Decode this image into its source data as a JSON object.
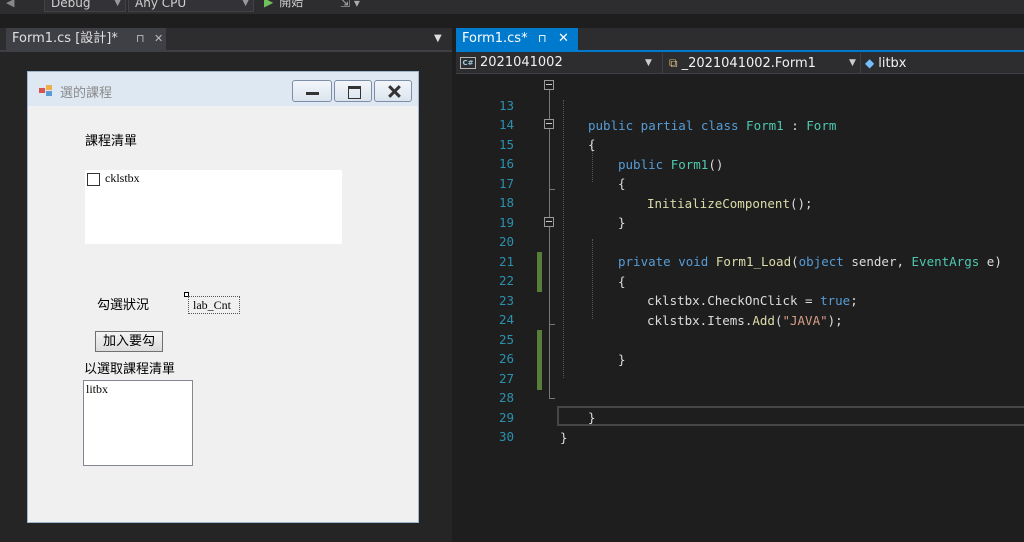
{
  "toolbar": {
    "config": "Debug",
    "platform": "Any CPU",
    "start": "開始"
  },
  "designer_tab": {
    "label": "Form1.cs [設計]*",
    "pin": "⊓",
    "close": "✕",
    "dropdown": "▼"
  },
  "form": {
    "title": "選的課程",
    "course_list_label": "課程清單",
    "checklist_name": "cklstbx",
    "status_label": "勾選狀況",
    "count_label": "lab_Cnt",
    "add_button": "加入要勾",
    "selected_label": "以選取課程清單",
    "listbox_name": "litbx"
  },
  "code_tab": {
    "label": "Form1.cs*",
    "pin": "⊓",
    "close": "✕"
  },
  "navbar": {
    "project": "2021041002",
    "class": "_2021041002.Form1",
    "member": "litbx"
  },
  "code": {
    "lines": [
      {
        "n": "13",
        "text": "public partial class Form1 : Form"
      },
      {
        "n": "14",
        "text": "{"
      },
      {
        "n": "15",
        "text": "public Form1()"
      },
      {
        "n": "16",
        "text": "{"
      },
      {
        "n": "17",
        "text": "InitializeComponent();"
      },
      {
        "n": "18",
        "text": "}"
      },
      {
        "n": "19",
        "text": ""
      },
      {
        "n": "20",
        "text": "private void Form1_Load(object sender, EventArgs e)"
      },
      {
        "n": "21",
        "text": "{"
      },
      {
        "n": "22",
        "text": "cklstbx.CheckOnClick = true;"
      },
      {
        "n": "23",
        "text": "cklstbx.Items.Add(\"JAVA\");"
      },
      {
        "n": "24",
        "text": ""
      },
      {
        "n": "25",
        "text": "}"
      },
      {
        "n": "26",
        "text": ""
      },
      {
        "n": "27",
        "text": ""
      },
      {
        "n": "28",
        "text": "}"
      },
      {
        "n": "29",
        "text": "}"
      },
      {
        "n": "30",
        "text": ""
      }
    ]
  },
  "colors": {
    "keyword": "#569cd6",
    "type": "#4ec9b0",
    "string": "#d69d85",
    "method": "#dcdcaa",
    "line_number": "#2b91af",
    "accent": "#007acc",
    "change_bar": "#577f3a"
  }
}
